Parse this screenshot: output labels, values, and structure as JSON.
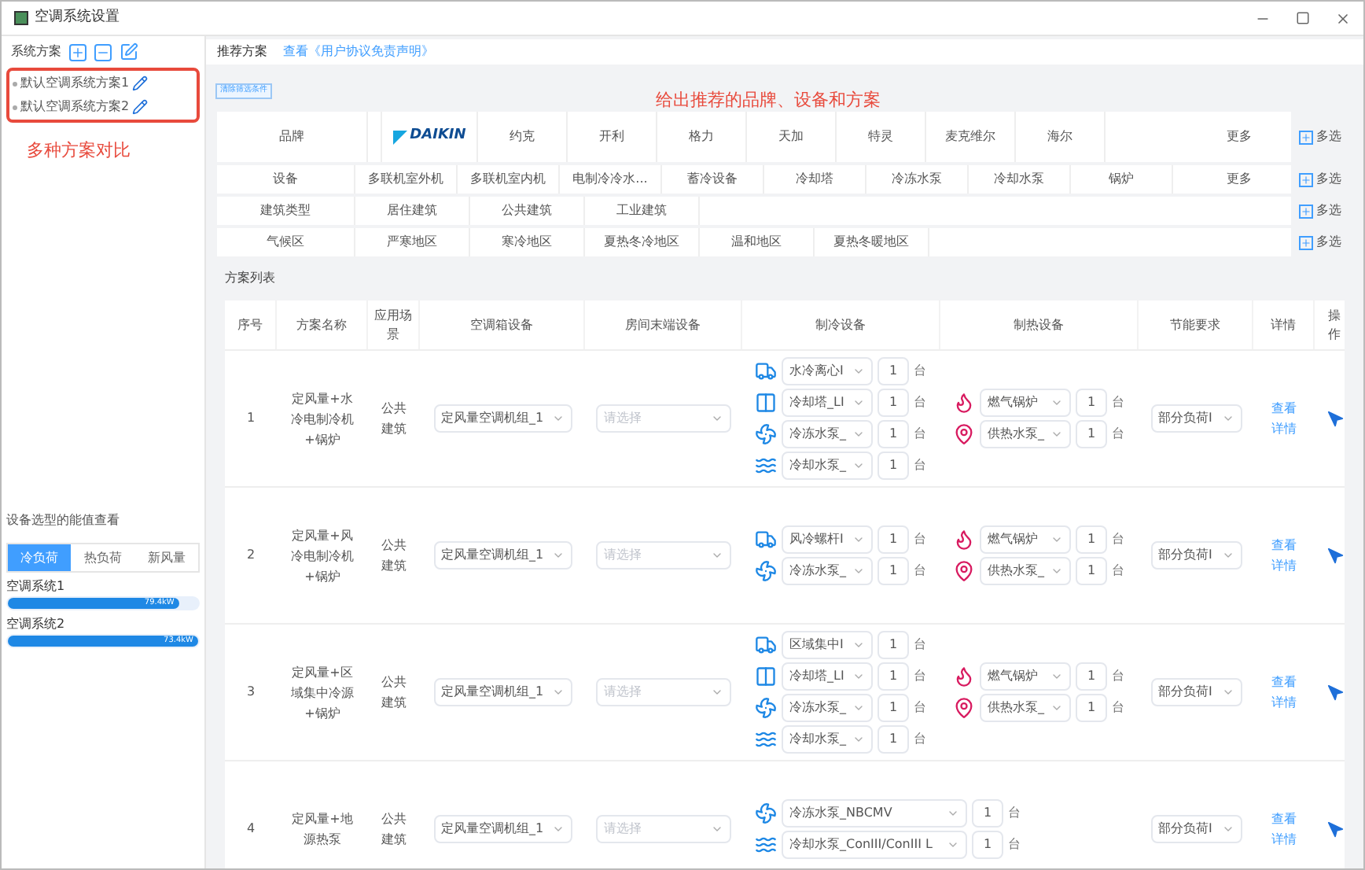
{
  "window": {
    "title": "空调系统设置"
  },
  "sidebar": {
    "title": "系统方案",
    "schemes": [
      {
        "label": "默认空调系统方案1"
      },
      {
        "label": "默认空调系统方案2"
      }
    ],
    "annotation": "多种方案对比",
    "load_panel": {
      "title": "设备选型的能值查看",
      "tabs": [
        {
          "label": "冷负荷",
          "selected": true
        },
        {
          "label": "热负荷",
          "selected": false
        },
        {
          "label": "新风量",
          "selected": false
        }
      ],
      "systems": [
        {
          "name": "空调系统1",
          "level": 0.9,
          "reading": "79.4kW"
        },
        {
          "name": "空调系统2",
          "level": 1,
          "reading": "73.4kW"
        }
      ]
    }
  },
  "main": {
    "tabs": [
      {
        "kind": "tab",
        "label": "推荐方案"
      },
      {
        "kind": "link",
        "label": "查看《用户协议免责声明》"
      }
    ],
    "clear_button": "清除筛选条件",
    "annotation": "给出推荐的品牌、设备和方案",
    "filters": [
      {
        "label": "品牌",
        "options": [
          {
            "kind": "logo",
            "label": "DAIKIN"
          },
          {
            "kind": "text",
            "label": "约克"
          },
          {
            "kind": "text",
            "label": "开利"
          },
          {
            "kind": "text",
            "label": "格力"
          },
          {
            "kind": "text",
            "label": "天加"
          },
          {
            "kind": "text",
            "label": "特灵"
          },
          {
            "kind": "text",
            "label": "麦克维尔"
          },
          {
            "kind": "text",
            "label": "海尔"
          }
        ],
        "more": "更多",
        "multi": "多选"
      },
      {
        "label": "设备",
        "options": [
          {
            "kind": "text",
            "label": "多联机室外机"
          },
          {
            "kind": "text",
            "label": "多联机室内机"
          },
          {
            "kind": "text",
            "label": "电制冷冷水..."
          },
          {
            "kind": "text",
            "label": "蓄冷设备"
          },
          {
            "kind": "text",
            "label": "冷却塔"
          },
          {
            "kind": "text",
            "label": "冷冻水泵"
          },
          {
            "kind": "text",
            "label": "冷却水泵"
          },
          {
            "kind": "text",
            "label": "锅炉"
          }
        ],
        "more": "更多",
        "multi": "多选"
      },
      {
        "label": "建筑类型",
        "options": [
          {
            "kind": "text",
            "label": "居住建筑"
          },
          {
            "kind": "text",
            "label": "公共建筑"
          },
          {
            "kind": "text",
            "label": "工业建筑"
          }
        ],
        "multi": "多选"
      },
      {
        "label": "气候区",
        "options": [
          {
            "kind": "text",
            "label": "严寒地区"
          },
          {
            "kind": "text",
            "label": "寒冷地区"
          },
          {
            "kind": "text",
            "label": "夏热冬冷地区"
          },
          {
            "kind": "text",
            "label": "温和地区"
          },
          {
            "kind": "text",
            "label": "夏热冬暖地区"
          }
        ],
        "multi": "多选"
      }
    ],
    "list_title": "方案列表",
    "table": {
      "columns": [
        "序号",
        "方案名称",
        "应用场景",
        "空调箱设备",
        "房间末端设备",
        "制冷设备",
        "制热设备",
        "节能要求",
        "详情",
        "操作"
      ],
      "rows": [
        {
          "index": "1",
          "name": "定风量+水冷电制冷机+锅炉",
          "scene": "公共建筑",
          "ahu": "定风量空调机组_1",
          "terminal_placeholder": "请选择",
          "cooling": [
            {
              "kind": "chiller",
              "value": "水冷离心I",
              "qty": "1",
              "unit": "台"
            },
            {
              "kind": "tower",
              "value": "冷却塔_LI",
              "qty": "1",
              "unit": "台"
            },
            {
              "kind": "pump",
              "value": "冷冻水泵_",
              "qty": "1",
              "unit": "台"
            },
            {
              "kind": "coolpump",
              "value": "冷却水泵_",
              "qty": "1",
              "unit": "台"
            }
          ],
          "heating": [
            {
              "kind": "boiler",
              "value": "燃气锅炉",
              "qty": "1",
              "unit": "台"
            },
            {
              "kind": "heatpump",
              "value": "供热水泵_",
              "qty": "1",
              "unit": "台"
            }
          ],
          "saving": "部分负荷I",
          "detail": "查看详情"
        },
        {
          "index": "2",
          "name": "定风量+风冷电制冷机+锅炉",
          "scene": "公共建筑",
          "ahu": "定风量空调机组_1",
          "terminal_placeholder": "请选择",
          "cooling": [
            {
              "kind": "chiller",
              "value": "风冷螺杆I",
              "qty": "1",
              "unit": "台"
            },
            {
              "kind": "pump",
              "value": "冷冻水泵_",
              "qty": "1",
              "unit": "台"
            }
          ],
          "heating": [
            {
              "kind": "boiler",
              "value": "燃气锅炉",
              "qty": "1",
              "unit": "台"
            },
            {
              "kind": "heatpump",
              "value": "供热水泵_",
              "qty": "1",
              "unit": "台"
            }
          ],
          "saving": "部分负荷I",
          "detail": "查看详情"
        },
        {
          "index": "3",
          "name": "定风量+区域集中冷源+锅炉",
          "scene": "公共建筑",
          "ahu": "定风量空调机组_1",
          "terminal_placeholder": "请选择",
          "cooling": [
            {
              "kind": "chiller",
              "value": "区域集中I",
              "qty": "1",
              "unit": "台"
            },
            {
              "kind": "tower",
              "value": "冷却塔_LI",
              "qty": "1",
              "unit": "台"
            },
            {
              "kind": "pump",
              "value": "冷冻水泵_",
              "qty": "1",
              "unit": "台"
            },
            {
              "kind": "coolpump",
              "value": "冷却水泵_",
              "qty": "1",
              "unit": "台"
            }
          ],
          "heating": [
            {
              "kind": "boiler",
              "value": "燃气锅炉",
              "qty": "1",
              "unit": "台"
            },
            {
              "kind": "heatpump",
              "value": "供热水泵_",
              "qty": "1",
              "unit": "台"
            }
          ],
          "saving": "部分负荷I",
          "detail": "查看详情"
        },
        {
          "index": "4",
          "name": "定风量+地源热泵",
          "scene": "公共建筑",
          "ahu": "定风量空调机组_1",
          "terminal_placeholder": "请选择",
          "cooling": [
            {
              "kind": "pump",
              "value": "冷冻水泵_NBCMV",
              "qty": "1",
              "unit": "台"
            },
            {
              "kind": "coolpump",
              "value": "冷却水泵_ConIII/ConIII L",
              "qty": "1",
              "unit": "台"
            }
          ],
          "heating": [],
          "saving": "部分负荷I",
          "detail": "查看详情"
        }
      ]
    }
  }
}
